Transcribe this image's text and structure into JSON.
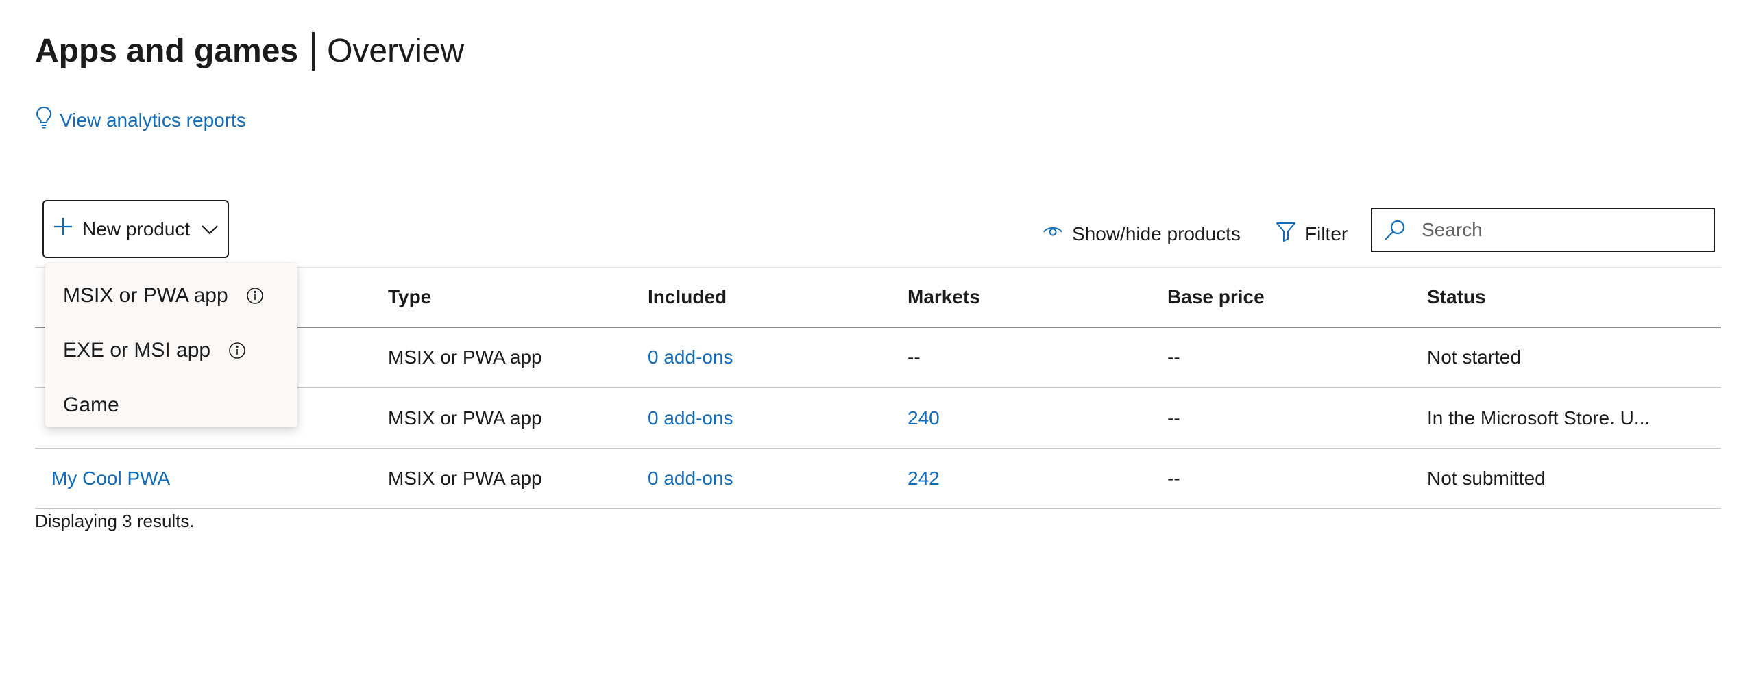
{
  "header": {
    "title": "Apps and games",
    "subtitle": "Overview",
    "analytics_link": "View analytics reports"
  },
  "toolbar": {
    "new_product_label": "New product",
    "show_hide_label": "Show/hide products",
    "filter_label": "Filter",
    "search_placeholder": "Search",
    "search_value": ""
  },
  "menu": {
    "items": [
      {
        "label": "MSIX or PWA app",
        "icon": "info-icon"
      },
      {
        "label": "EXE or MSI app",
        "icon": "info-icon"
      },
      {
        "label": "Game"
      }
    ]
  },
  "table": {
    "columns": [
      "Type",
      "Included",
      "Markets",
      "Base price",
      "Status"
    ],
    "rows": [
      {
        "name": "",
        "type": "MSIX or PWA app",
        "included": "0 add-ons",
        "markets": "--",
        "base_price": "--",
        "status": "Not started"
      },
      {
        "name": "",
        "type": "MSIX or PWA app",
        "included": "0 add-ons",
        "markets": "240",
        "base_price": "--",
        "status": "In the Microsoft Store. U..."
      },
      {
        "name": "My Cool PWA",
        "type": "MSIX or PWA app",
        "included": "0 add-ons",
        "markets": "242",
        "base_price": "--",
        "status": "Not submitted"
      }
    ]
  },
  "footer": {
    "results_text": "Displaying 3 results."
  },
  "colors": {
    "link": "#0f6cbd",
    "text": "#1b1b1b",
    "menu_bg": "#faf9f8"
  }
}
